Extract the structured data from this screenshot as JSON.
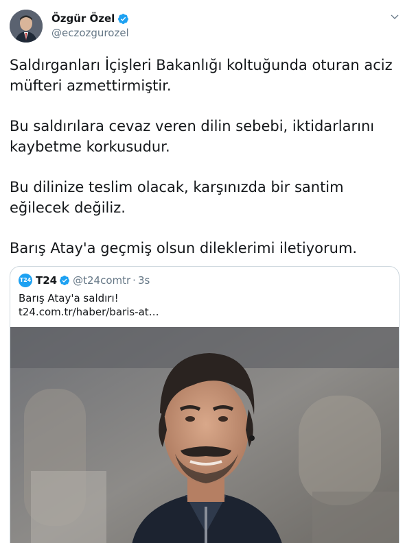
{
  "author": {
    "name": "Özgür Özel",
    "handle": "@eczozgurozel",
    "verified_icon": "verified-badge-icon",
    "avatar_icon": "avatar"
  },
  "menu": {
    "caret_icon": "chevron-down-icon"
  },
  "tweet": {
    "paragraphs": [
      "Saldırganları İçişleri Bakanlığı koltuğunda oturan aciz müfteri azmettirmiştir.",
      "Bu saldırılara cevaz veren dilin sebebi, iktidarlarını kaybetme korkusudur.",
      "Bu dilinize teslim olacak, karşınızda bir santim eğilecek değiliz.",
      "Barış Atay'a geçmiş olsun dileklerimi iletiyorum."
    ]
  },
  "quote": {
    "logo_text": "T24",
    "name": "T24",
    "handle": "@t24comtr",
    "separator": "·",
    "time": "3s",
    "text": "Barış Atay'a saldırı!",
    "link": "t24.com.tr/haber/baris-at…"
  },
  "colors": {
    "accent": "#1da1f2",
    "text": "#14171a",
    "secondary": "#657786",
    "border": "#ccd6dd"
  }
}
